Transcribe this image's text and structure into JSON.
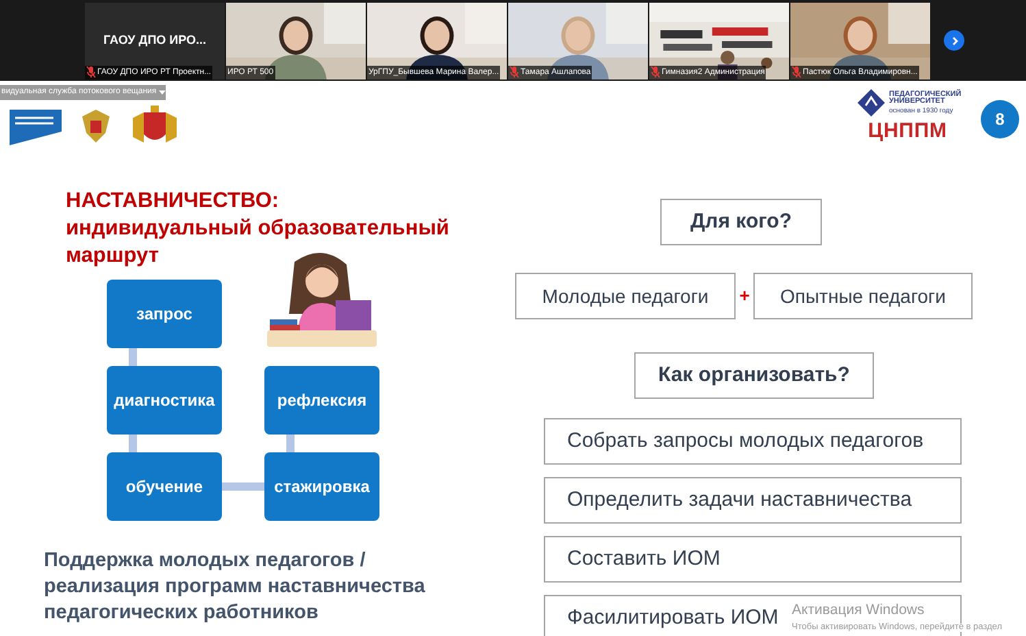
{
  "video_strip": {
    "tiles": [
      {
        "kind": "name",
        "caption": "ГАОУ ДПО ИРО...",
        "label": "ГАОУ ДПО ИРО РТ Проектн...",
        "muted": true
      },
      {
        "kind": "video",
        "label": "ИРО РТ 500",
        "muted": false
      },
      {
        "kind": "video",
        "label": "УрГПУ_Бывшева Марина Валер...",
        "muted": false
      },
      {
        "kind": "video",
        "label": "Тамара Ашлапова",
        "muted": true
      },
      {
        "kind": "video",
        "label": "Гимназия2 Администрация",
        "muted": true
      },
      {
        "kind": "video",
        "label": "Пастюк Ольга Владимировн...",
        "muted": true
      }
    ]
  },
  "stream_bar": {
    "label": "видуальная служба потокового вещания"
  },
  "slide": {
    "logo_texts": [
      "ПЕДАГОГИЧЕСКИЙ УНИВЕРСИТЕТ",
      "основан в 1930 году",
      "ЦНППМ"
    ],
    "page_number": "8",
    "title": "НАСТАВНИЧЕСТВО:",
    "subtitle": "индивидуальный образовательный маршрут",
    "diagram": {
      "nodes": [
        "запрос",
        "диагностика",
        "обучение",
        "рефлексия",
        "стажировка"
      ]
    },
    "caption": "Поддержка молодых педагогов / реализация программ наставничества педагогических работников",
    "question_1": "Для кого?",
    "audiences": [
      "Молодые педагоги",
      "Опытные педагоги"
    ],
    "joiner": "+",
    "question_2": "Как организовать?",
    "steps": [
      "Собрать запросы молодых педагогов",
      "Определить задачи наставничества",
      "Составить ИОМ",
      "Фасилитировать ИОМ"
    ]
  },
  "os_watermark": {
    "title": "Активация Windows",
    "hint": "Чтобы активировать Windows, перейдите в раздел"
  }
}
